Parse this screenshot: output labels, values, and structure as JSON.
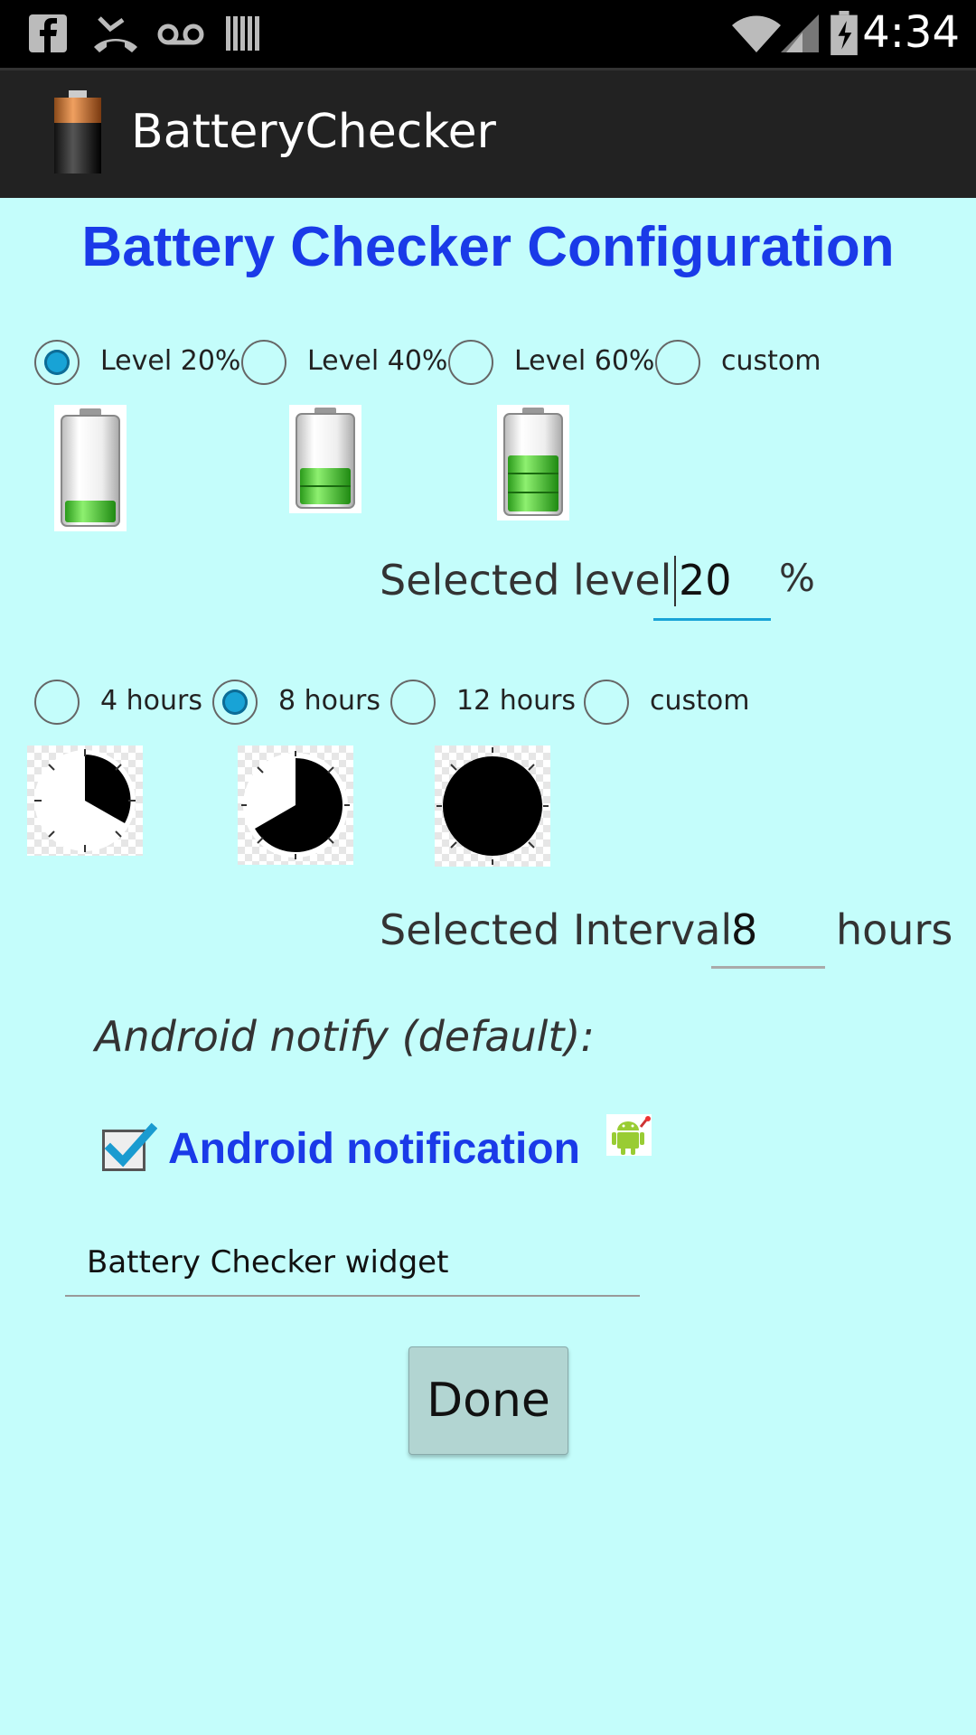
{
  "status_bar": {
    "time": "4:34"
  },
  "action_bar": {
    "title": "BatteryChecker"
  },
  "page_title": "Battery Checker Configuration",
  "level_options": [
    {
      "label": "Level 20%",
      "checked": true
    },
    {
      "label": "Level 40%",
      "checked": false
    },
    {
      "label": "Level 60%",
      "checked": false
    },
    {
      "label": "custom",
      "checked": false
    }
  ],
  "selected_level": {
    "label": "Selected level",
    "value": "20",
    "unit": "%"
  },
  "interval_options": [
    {
      "label": "4 hours",
      "checked": false
    },
    {
      "label": "8 hours",
      "checked": true
    },
    {
      "label": "12 hours",
      "checked": false
    },
    {
      "label": "custom",
      "checked": false
    }
  ],
  "selected_interval": {
    "label": "Selected Interval",
    "value": "8",
    "unit": "hours"
  },
  "notify_heading": "Android notify (default):",
  "notification_checkbox": {
    "label": "Android notification",
    "checked": true
  },
  "widget_name": "Battery Checker widget",
  "done_label": "Done",
  "colors": {
    "background": "#c4fdfb",
    "accent_blue": "#1a3ae8",
    "radio_fill": "#18a3d6"
  }
}
